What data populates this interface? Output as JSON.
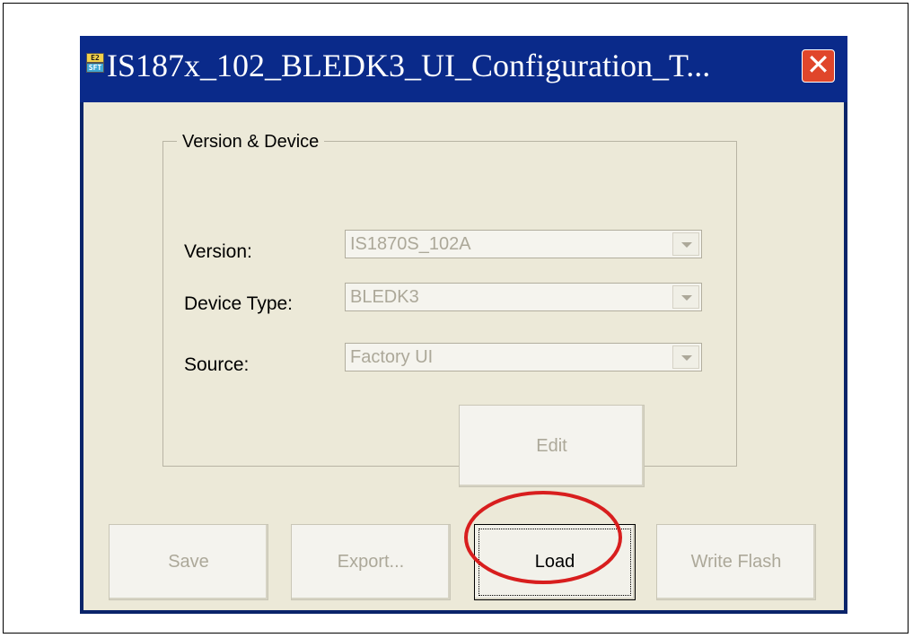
{
  "window": {
    "title": "IS187x_102_BLEDK3_UI_Configuration_T...",
    "icon_text_top": "E2",
    "icon_text_bottom": "SFT",
    "close_glyph": "✕"
  },
  "group": {
    "label": "Version & Device",
    "fields": [
      {
        "label": "Version:",
        "value": "IS1870S_102A"
      },
      {
        "label": "Device Type:",
        "value": "BLEDK3"
      },
      {
        "label": "Source:",
        "value": "Factory UI"
      }
    ],
    "edit_button": "Edit"
  },
  "buttons": {
    "save": "Save",
    "export": "Export...",
    "load": "Load",
    "write_flash": "Write Flash"
  },
  "colors": {
    "titlebar": "#0a2a8a",
    "client_bg": "#ece9d8",
    "disabled_text": "#aca899",
    "highlight": "#d81e1e",
    "close_button": "#e0462b"
  },
  "annotation": {
    "shape": "ellipse",
    "target": "load-button"
  }
}
